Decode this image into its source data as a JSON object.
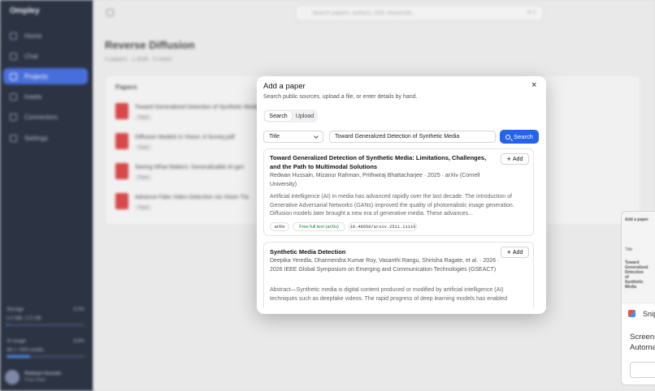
{
  "sidebar": {
    "brand": "Ompley",
    "items": [
      {
        "label": "Home"
      },
      {
        "label": "Chat"
      },
      {
        "label": "Projects"
      },
      {
        "label": "Insets"
      },
      {
        "label": "Connectors"
      },
      {
        "label": "Settings"
      }
    ],
    "storage": {
      "label": "Storage",
      "value": "0.0%",
      "detail": "0.0 MB / 2.0 GB",
      "fill": 0.02
    },
    "ai_usage": {
      "label": "AI usage",
      "value": "9.6%",
      "detail": "48.1 / 500 credits",
      "fill": 0.3
    },
    "user": {
      "name": "Redwan Hussain",
      "plan": "Free Plan"
    }
  },
  "main": {
    "search_placeholder": "Search papers, authors, DOI, keywords...",
    "search_shortcut": "⌘ K",
    "title": "Reverse Diffusion",
    "subtitle": "4 papers · 1 draft · 0 notes",
    "papers_heading": "Papers",
    "papers": [
      {
        "title": "Toward Generalized Detection of Synthetic Media",
        "tag": "Paper"
      },
      {
        "title": "Diffusion Models in Vision: A Survey.pdf",
        "tag": "Paper"
      },
      {
        "title": "Seeing What Matters: Generalizable AI-gen",
        "tag": "Paper"
      },
      {
        "title": "Advance Fake Video Detection via Vision Tra",
        "tag": "Paper"
      }
    ]
  },
  "modal": {
    "title": "Add a paper",
    "subtitle": "Search public sources, upload a file, or enter details by hand.",
    "close_label": "×",
    "tabs": [
      {
        "label": "Search"
      },
      {
        "label": "Upload"
      }
    ],
    "field_select": "Title",
    "query": "Toward Generalized Detection of Synthetic Media",
    "search_button": "Search",
    "results": [
      {
        "title": "Toward Generalized Detection of Synthetic Media: Limitations, Challenges, and the Path to Multimodal Solutions",
        "authors": "Redwan Hussain, Mizanur Rahman, Prithwiraj Bhattacharjee · 2025 · arXiv (Cornell University)",
        "abstract": "Artificial intelligence (AI) in media has advanced rapidly over the last decade. The introduction of Generative Adversarial Networks (GANs) improved the quality of photorealistic image generation. Diffusion models later brought a new era of generative media. These advances...",
        "add_label": "Add",
        "chips": [
          "arXiv",
          "Free full text (arXiv)",
          "10.48550/arxiv.2511.11116"
        ]
      },
      {
        "title": "Synthetic Media Detection",
        "authors": "Deepika Yeredla, Dharmendra Kumar Roy, Vasanthi Rangu, Shirisha Ragate, et al. · 2026 · 2026 IEEE Global Symposium on Emerging and Communication Technologies (GSEACT)",
        "abstract": "Abstract—Synthetic media is digital content produced or modified by artificial intelligence (AI) techniques such as deepfake videos. The rapid progress of deep learning models has enabled",
        "add_label": "Add"
      }
    ]
  },
  "snip_preview": {
    "mini_title": "Add a paper",
    "mini_field": "Title",
    "mini_result": "Toward Generalized Detection of Synthetic Media",
    "app_name": "Snipping Tool",
    "message": "Screenshot copied to clipboard\nAutomatically saved to screenshots folder"
  }
}
